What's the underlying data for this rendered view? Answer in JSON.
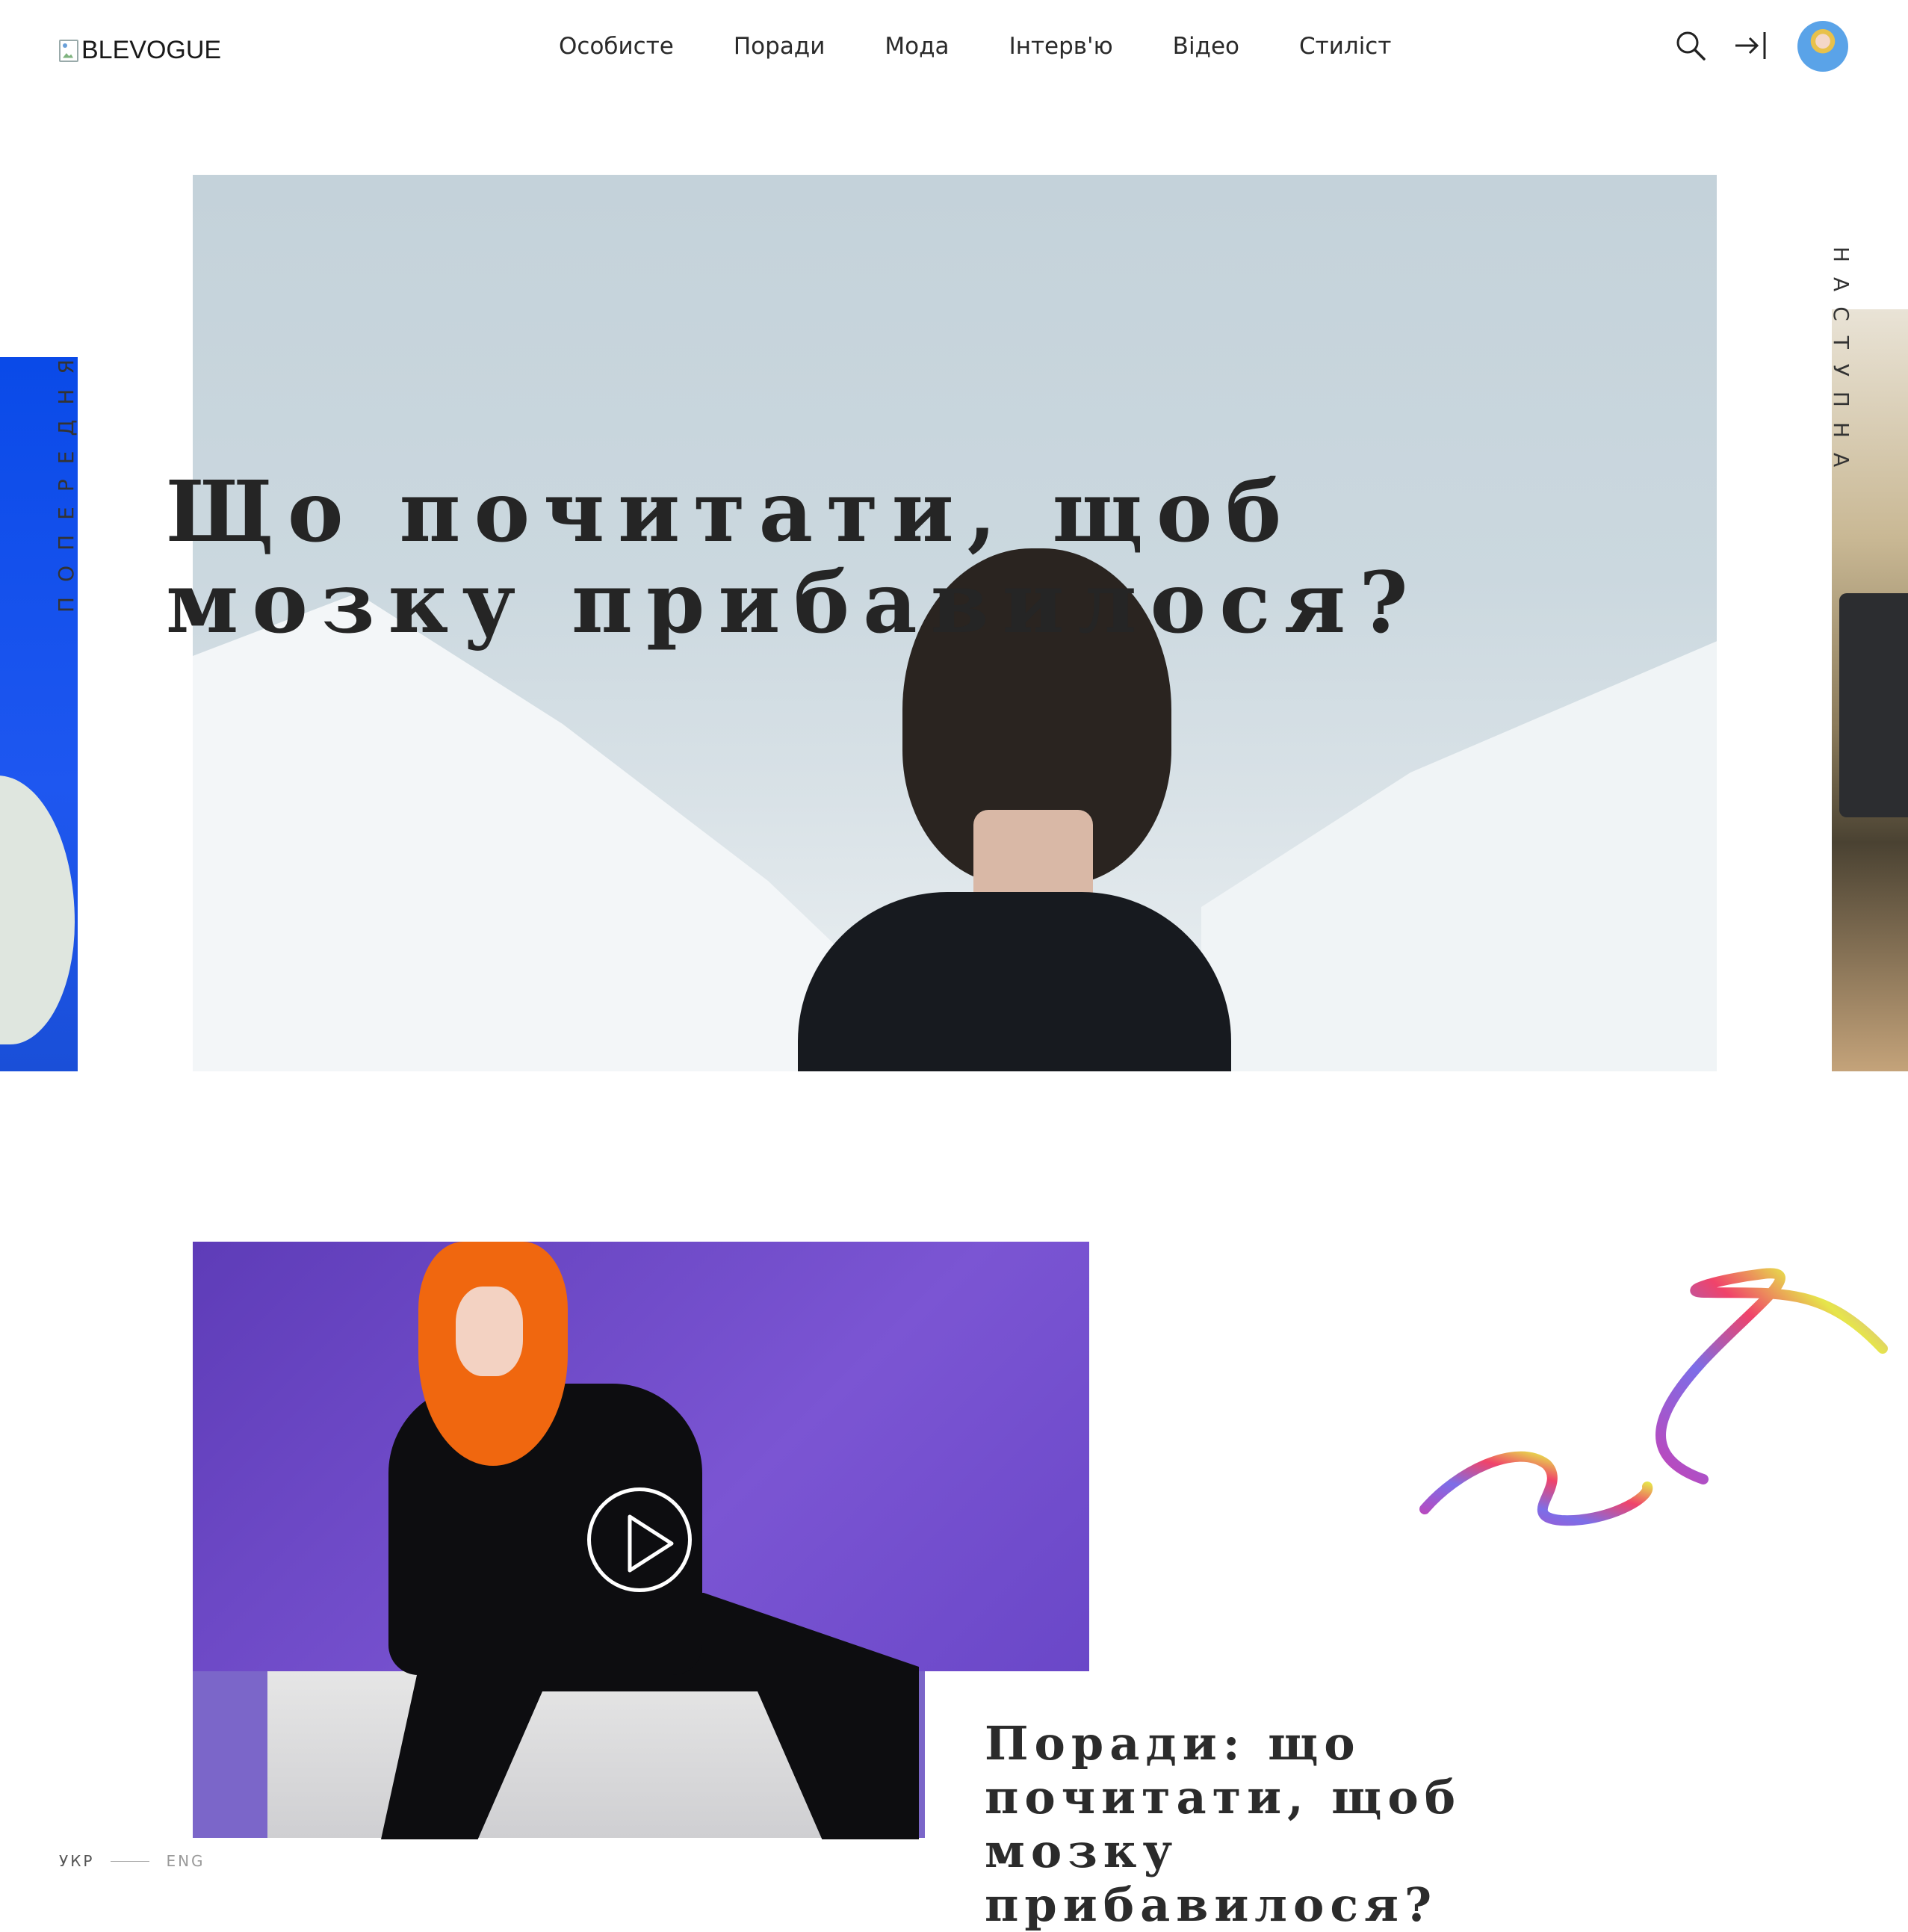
{
  "header": {
    "logo_text": "BLEVOGUE",
    "nav": [
      {
        "label": "Особисте"
      },
      {
        "label": "Поради"
      },
      {
        "label": "Мода"
      },
      {
        "label": "Інтерв'ю"
      },
      {
        "label": "Відео"
      },
      {
        "label": "Стиліст"
      }
    ],
    "icons": {
      "search": "search-icon",
      "login": "login-icon",
      "avatar": "user-avatar"
    }
  },
  "hero": {
    "title_line1": "Що почитати, щоб",
    "title_line2": "мозку прибавилося?"
  },
  "slider": {
    "prev_label": "ПОПЕРЕДНЯ",
    "next_label": "НАСТУПНА"
  },
  "post": {
    "title": "Поради: що почитати, щоб мозку прибавилося?",
    "play_icon": "play-icon"
  },
  "language": {
    "ukr": "УКР",
    "eng": "ENG"
  },
  "colors": {
    "accent_blue": "#1e57f0",
    "video_purple": "#6a47c8",
    "text_dark": "#2b2b2b"
  }
}
